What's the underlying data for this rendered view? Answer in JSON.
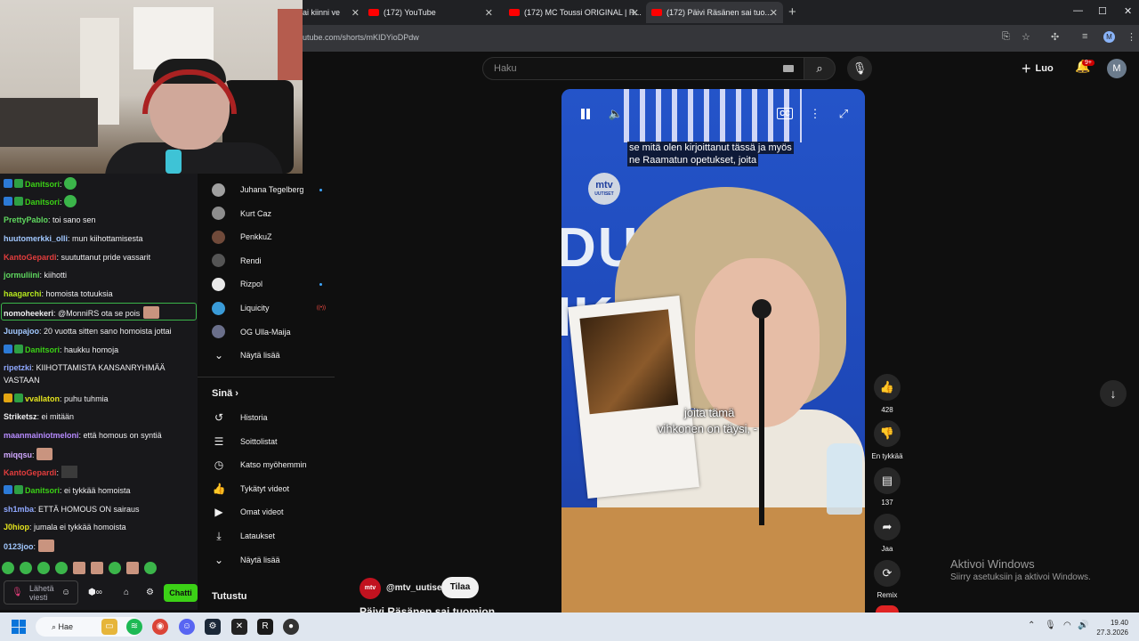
{
  "browser": {
    "tabs": [
      {
        "title": "ai kiinni ve",
        "active": false
      },
      {
        "title": "(172) YouTube",
        "active": false
      },
      {
        "title": "(172) MC Toussi ORIGINAL | R...",
        "active": false
      },
      {
        "title": "(172) Päivi Räsänen sai tuo...",
        "active": true
      }
    ],
    "url": "utube.com/shorts/mKIDYioDPdw",
    "profile_initial": "M"
  },
  "youtube": {
    "search_placeholder": "Haku",
    "create_label": "Luo",
    "notif_badge": "9+",
    "avatar_initial": "M"
  },
  "chat": {
    "messages": [
      {
        "user": "Danitsori",
        "color": "#3bd116",
        "text": "",
        "badges": [
          "prime",
          "sub"
        ],
        "emote": "green"
      },
      {
        "user": "Danitsori",
        "color": "#3bd116",
        "text": "",
        "badges": [
          "prime",
          "sub"
        ],
        "emote": "green"
      },
      {
        "user": "PrettyPablo",
        "color": "#5fd85f",
        "text": "toi sano sen"
      },
      {
        "user": "huutomerkki_olli",
        "color": "#a2c8ff",
        "text": "mun kiihottamisesta"
      },
      {
        "user": "KantoGepardi",
        "color": "#e23d3d",
        "text": "suututtanut pride vassarit"
      },
      {
        "user": "jormuliini",
        "color": "#5fd85f",
        "text": "kiihotti"
      },
      {
        "user": "haagarchi",
        "color": "#b6e81e",
        "text": "homoista totuuksia"
      },
      {
        "user": "nomoheekeri",
        "color": "#efeff1",
        "text": "@MonniRS ota se pois"
      },
      {
        "user": "Juupajoo",
        "color": "#a2c8ff",
        "text": "20 vuotta sitten sano homoista jottai"
      },
      {
        "user": "Danitsori",
        "color": "#3bd116",
        "text": "haukku homoja",
        "badges": [
          "prime",
          "sub"
        ]
      },
      {
        "user": "ripetzki",
        "color": "#8fa8ff",
        "text": "KIIHOTTAMISTA KANSANRYHMÄÄ VASTAAN"
      },
      {
        "user": "vvallaton",
        "color": "#e3e31e",
        "text": "puhu tuhmia",
        "badges": [
          "gold",
          "sub"
        ]
      },
      {
        "user": "Striketsz",
        "color": "#efeff1",
        "text": "ei mitään"
      },
      {
        "user": "maanmainiotmeloni",
        "color": "#b78bff",
        "text": "että homous on syntiä"
      },
      {
        "user": "miqqsu",
        "color": "#d0a8ff",
        "text": ""
      },
      {
        "user": "KantoGepardi",
        "color": "#e23d3d",
        "text": ""
      },
      {
        "user": "Danitsori",
        "color": "#3bd116",
        "text": "ei tykkää homoista",
        "badges": [
          "prime",
          "sub"
        ]
      },
      {
        "user": "sh1mba",
        "color": "#8fa8ff",
        "text": "ETTÄ HOMOUS ON sairaus"
      },
      {
        "user": "J0hiop",
        "color": "#e3e31e",
        "text": "jumala ei tykkää homoista"
      },
      {
        "user": "0123joo",
        "color": "#a2c8ff",
        "text": ""
      }
    ],
    "input_placeholder": "Lähetä viesti",
    "send_label": "Chatti"
  },
  "sidebar": {
    "subscriptions": [
      {
        "name": "Juhana Tegelberg",
        "avatar": "#a0a0a0",
        "indicator": "dot"
      },
      {
        "name": "Kurt Caz",
        "avatar": "#8d8d8d",
        "indicator": ""
      },
      {
        "name": "PenkkuZ",
        "avatar": "#704a3a",
        "indicator": ""
      },
      {
        "name": "Rendi",
        "avatar": "#555555",
        "indicator": ""
      },
      {
        "name": "Rizpol",
        "avatar": "#e8e8e8",
        "indicator": "dot"
      },
      {
        "name": "Liquicity",
        "avatar": "#3a9bd8",
        "indicator": "live"
      },
      {
        "name": "OG Ulla-Maija",
        "avatar": "#6a6f8a",
        "indicator": ""
      }
    ],
    "show_more": "Näytä lisää",
    "you_header": "Sinä",
    "you_items": [
      {
        "label": "Historia",
        "icon": "history-icon",
        "glyph": "↺"
      },
      {
        "label": "Soittolistat",
        "icon": "playlists-icon",
        "glyph": "☰"
      },
      {
        "label": "Katso myöhemmin",
        "icon": "watch-later-icon",
        "glyph": "◷"
      },
      {
        "label": "Tykätyt videot",
        "icon": "liked-videos-icon",
        "glyph": "👍"
      },
      {
        "label": "Omat videot",
        "icon": "your-videos-icon",
        "glyph": "▶"
      },
      {
        "label": "Lataukset",
        "icon": "downloads-icon",
        "glyph": "⤓"
      },
      {
        "label": "Näytä lisää",
        "icon": "chevron-down-icon",
        "glyph": "⌄"
      }
    ],
    "explore_header": "Tutustu"
  },
  "short": {
    "subtitle_line1": "se mitä olen kirjoittanut tässä ja myös",
    "subtitle_line2": "ne Raamatun opetukset, joita",
    "burned_caption_1": "joita tämä",
    "burned_caption_2": "vihkonen on täysi, -",
    "watermark": "mtv",
    "watermark_sub": "UUTISET",
    "channel": "@mtv_uutiset",
    "subscribe_label": "Tilaa",
    "title": "Päivi Räsänen sai tuomion",
    "cc_label": "CC",
    "like_count": "428",
    "dislike_label": "En tykkää",
    "comment_count": "137",
    "share_label": "Jaa",
    "remix_label": "Remix"
  },
  "watermark_windows": {
    "line1": "Aktivoi Windows",
    "line2": "Siirry asetuksiin ja aktivoi Windows."
  },
  "taskbar": {
    "search_label": "Hae",
    "time": "19.40",
    "date": "27.3.2026"
  }
}
